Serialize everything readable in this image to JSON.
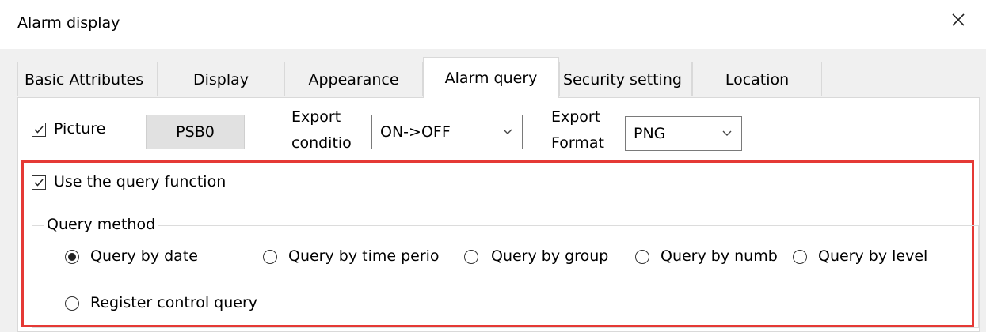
{
  "window": {
    "title": "Alarm display"
  },
  "tabs": [
    {
      "label": "Basic Attributes"
    },
    {
      "label": "Display"
    },
    {
      "label": "Appearance"
    },
    {
      "label": "Alarm query"
    },
    {
      "label": "Security setting"
    },
    {
      "label": "Location"
    }
  ],
  "active_tab": "Alarm query",
  "picture": {
    "label": "Picture",
    "checked": true,
    "button_label": "PSB0"
  },
  "export_condition": {
    "label_line1": "Export",
    "label_line2": "conditio",
    "value": "ON->OFF"
  },
  "export_format": {
    "label_line1": "Export",
    "label_line2": "Format",
    "value": "PNG"
  },
  "query": {
    "use_label": "Use the query function",
    "use_checked": true,
    "group_title": "Query method",
    "options": [
      {
        "label": "Query by date",
        "selected": true
      },
      {
        "label": "Query by time perio",
        "selected": false
      },
      {
        "label": "Query by group",
        "selected": false
      },
      {
        "label": "Query by numb",
        "selected": false
      },
      {
        "label": "Query by level",
        "selected": false
      },
      {
        "label": "Register control query",
        "selected": false
      }
    ]
  },
  "colors": {
    "highlight_border": "#e53935",
    "panel_bg": "#ffffff",
    "dialog_bg": "#f0f0f0"
  }
}
